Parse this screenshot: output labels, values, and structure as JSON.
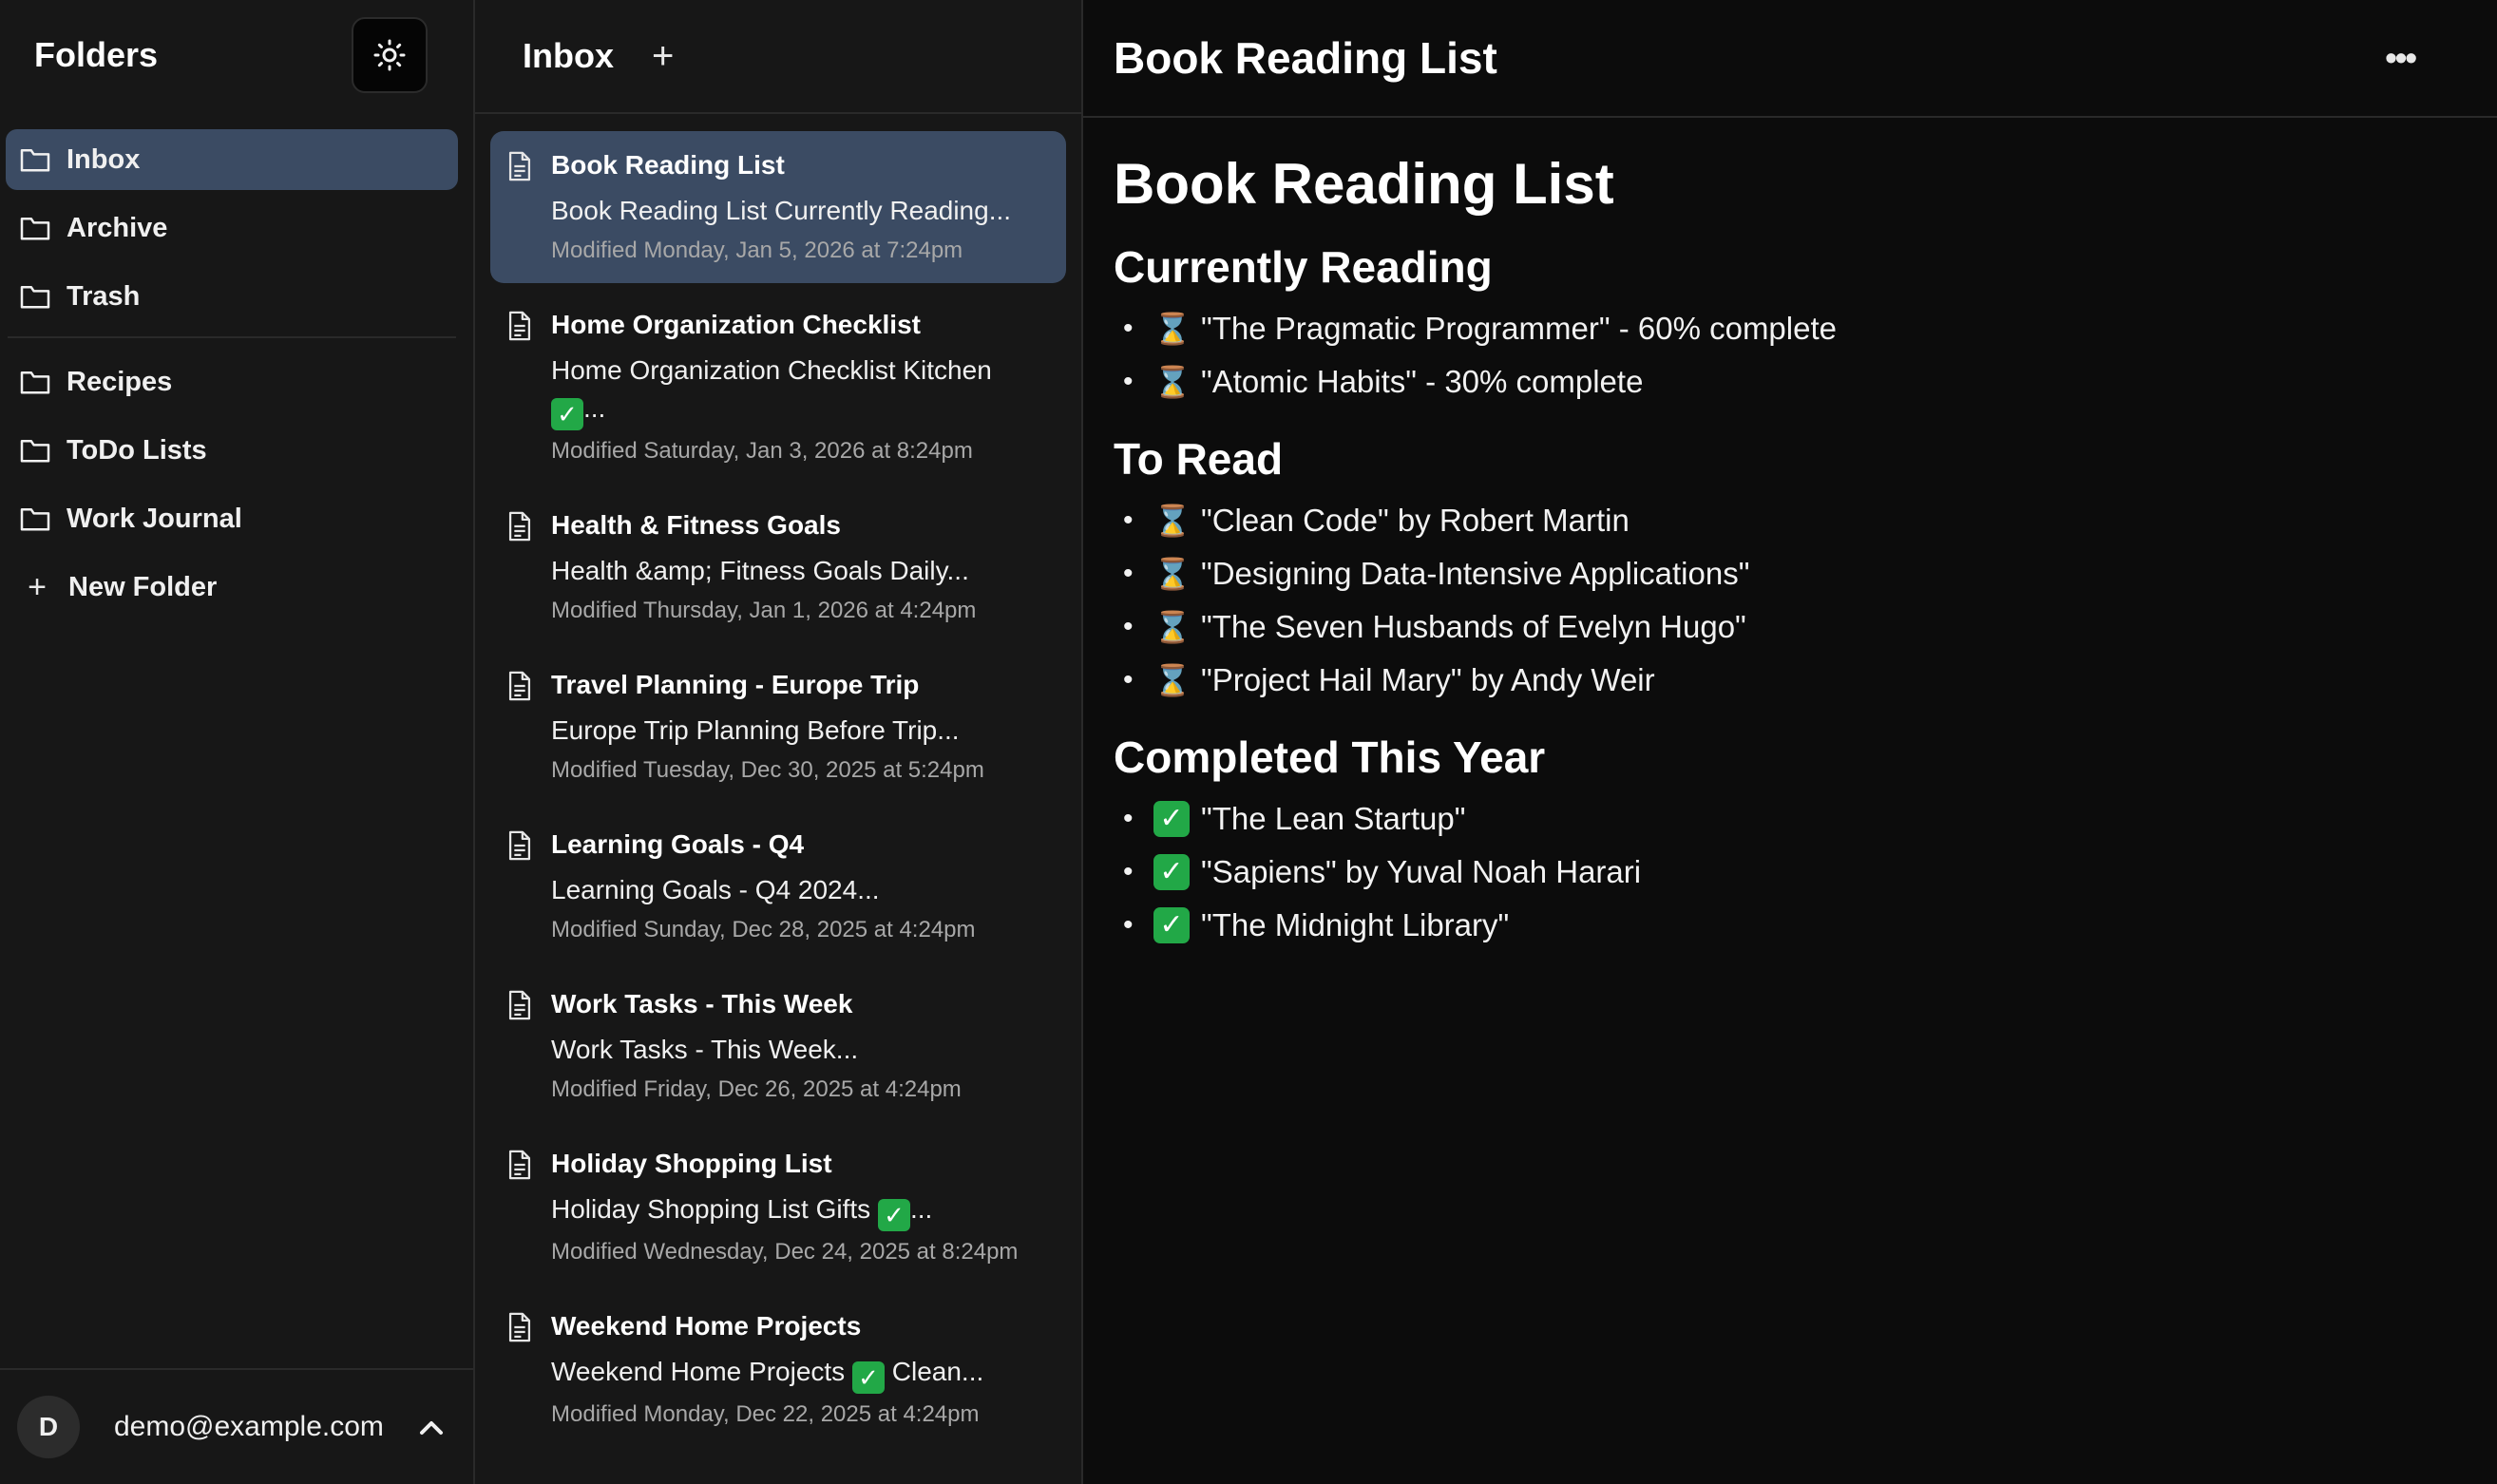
{
  "sidebar": {
    "title": "Folders",
    "theme_icon": "sun-icon",
    "folders": [
      {
        "label": "Inbox",
        "active": true
      },
      {
        "label": "Archive"
      },
      {
        "label": "Trash"
      }
    ],
    "user_folders": [
      {
        "label": "Recipes"
      },
      {
        "label": "ToDo Lists"
      },
      {
        "label": "Work Journal"
      }
    ],
    "new_folder_label": "New Folder",
    "account": {
      "initial": "D",
      "email": "demo@example.com"
    }
  },
  "notes": {
    "title": "Inbox",
    "add_glyph": "+",
    "items": [
      {
        "title": "Book Reading List",
        "preview": "Book Reading List Currently Reading...",
        "modified": "Modified Monday, Jan 5, 2026 at 7:24pm",
        "active": true
      },
      {
        "title": "Home Organization Checklist",
        "preview_a": "Home Organization Checklist Kitchen",
        "preview_b": "...",
        "modified": "Modified Saturday, Jan 3, 2026 at 8:24pm"
      },
      {
        "title": "Health & Fitness Goals",
        "preview": "Health &amp; Fitness Goals Daily...",
        "modified": "Modified Thursday, Jan 1, 2026 at 4:24pm"
      },
      {
        "title": "Travel Planning - Europe Trip",
        "preview": "Europe Trip Planning Before Trip...",
        "modified": "Modified Tuesday, Dec 30, 2025 at 5:24pm"
      },
      {
        "title": "Learning Goals - Q4",
        "preview": "Learning Goals - Q4 2024...",
        "modified": "Modified Sunday, Dec 28, 2025 at 4:24pm"
      },
      {
        "title": "Work Tasks - This Week",
        "preview": "Work Tasks - This Week...",
        "modified": "Modified Friday, Dec 26, 2025 at 4:24pm"
      },
      {
        "title": "Holiday Shopping List",
        "preview_a": "Holiday Shopping List Gifts",
        "preview_b": "...",
        "modified": "Modified Wednesday, Dec 24, 2025 at 8:24pm"
      },
      {
        "title": "Weekend Home Projects",
        "preview_a": "Weekend Home Projects",
        "preview_b": "Clean...",
        "modified": "Modified Monday, Dec 22, 2025 at 4:24pm"
      }
    ]
  },
  "editor": {
    "title": "Book Reading List",
    "more_glyph": "•••",
    "doc": {
      "h1": "Book Reading List",
      "sections": [
        {
          "heading": "Currently Reading",
          "icon": "hourglass",
          "items": [
            "\"The Pragmatic Programmer\" - 60% complete",
            "\"Atomic Habits\" - 30% complete"
          ]
        },
        {
          "heading": "To Read",
          "icon": "hourglass",
          "items": [
            "\"Clean Code\" by Robert Martin",
            "\"Designing Data-Intensive Applications\"",
            "\"The Seven Husbands of Evelyn Hugo\"",
            "\"Project Hail Mary\" by Andy Weir"
          ]
        },
        {
          "heading": "Completed This Year",
          "icon": "check",
          "items": [
            "\"The Lean Startup\"",
            "\"Sapiens\" by Yuval Noah Harari",
            "\"The Midnight Library\""
          ]
        }
      ]
    }
  },
  "colors": {
    "background": "#0c0c0c",
    "panel": "#171717",
    "selected": "#3b4b63",
    "check_green": "#22a847"
  }
}
